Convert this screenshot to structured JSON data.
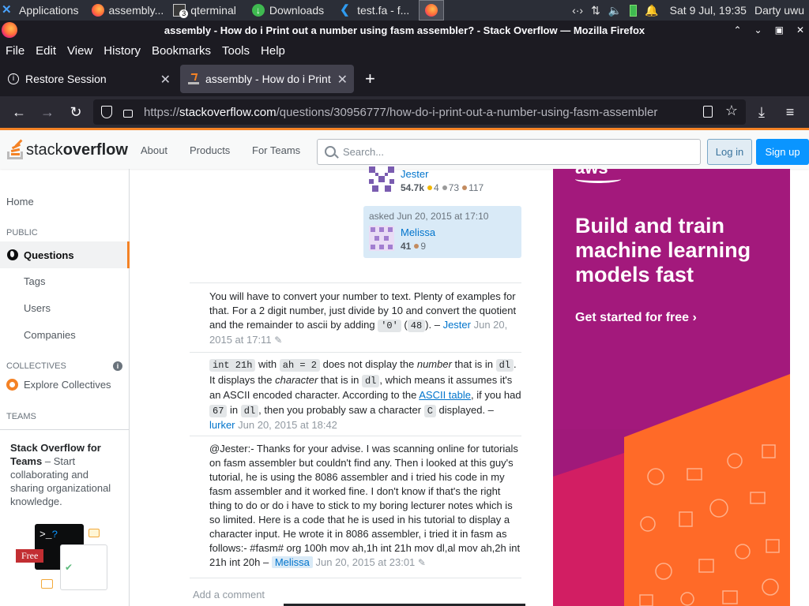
{
  "panel": {
    "applications": "Applications",
    "tasks": [
      {
        "label": "assembly..."
      },
      {
        "label": "qterminal"
      },
      {
        "label": "Downloads"
      },
      {
        "label": "test.fa - f..."
      }
    ],
    "terminal_badge": "3",
    "datetime": "Sat  9 Jul, 19:35",
    "user": "Darty uwu"
  },
  "window": {
    "title": "assembly - How do i Print out a number using fasm assembler? - Stack Overflow — Mozilla Firefox"
  },
  "menu": [
    "File",
    "Edit",
    "View",
    "History",
    "Bookmarks",
    "Tools",
    "Help"
  ],
  "tabs": [
    {
      "label": "Restore Session"
    },
    {
      "label": "assembly - How do i Print out"
    }
  ],
  "url": {
    "scheme": "https://",
    "host": "stackoverflow.com",
    "path": "/questions/30956777/how-do-i-print-out-a-number-using-fasm-assembler"
  },
  "so_header": {
    "logo_part1": "stack",
    "logo_part2": "overflow",
    "nav": [
      "About",
      "Products",
      "For Teams"
    ],
    "search_placeholder": "Search...",
    "login": "Log in",
    "signup": "Sign up"
  },
  "sidebar": {
    "home": "Home",
    "public": "PUBLIC",
    "questions": "Questions",
    "tags": "Tags",
    "users": "Users",
    "companies": "Companies",
    "collectives": "COLLECTIVES",
    "explore_collectives": "Explore Collectives",
    "teams": "TEAMS",
    "teams_title": "Stack Overflow for Teams",
    "teams_desc": " – Start collaborating and sharing organizational knowledge.",
    "free_badge": "Free"
  },
  "post": {
    "editor": {
      "name": "Jester",
      "rep": "54.7k",
      "gold": "4",
      "silver": "73",
      "bronze": "117"
    },
    "asked_label": "asked Jun 20, 2015 at 17:10",
    "asker": {
      "name": "Melissa",
      "rep": "41",
      "bronze": "9"
    }
  },
  "comments": [
    {
      "text1": "You will have to convert your number to text. Plenty of examples for that. For a 2 digit number, just divide by 10 and convert the quotient and the remainder to ascii by adding ",
      "code1": "'0'",
      "text2": " (",
      "code2": "48",
      "text3": "). –",
      "user": "Jester",
      "date": "Jun 20, 2015 at 17:11"
    },
    {
      "code1": "int 21h",
      "text1": " with ",
      "code2": "ah = 2",
      "text2": " does not display the ",
      "em1": "number",
      "text3": " that is in ",
      "code3": "dl",
      "text4": ". It displays the ",
      "em2": "character",
      "text5": " that is in ",
      "code4": "dl",
      "text6": ", which means it assumes it's an ASCII encoded character. According to the ",
      "link": "ASCII table",
      "text7": ", if you had ",
      "code5": "67",
      "text8": " in ",
      "code6": "dl",
      "text9": ", then you probably saw a character ",
      "code7": "C",
      "text10": " displayed. –",
      "user": "lurker",
      "date": "Jun 20, 2015 at 18:42"
    },
    {
      "text": "@Jester:- Thanks for your advise. I was scanning online for tutorials on fasm assembler but couldn't find any. Then i looked at this guy's tutorial, he is using the 8086 assembler and i tried his code in my fasm assembler and it worked fine. I don't know if that's the right thing to do or do i have to stick to my boring lecturer notes which is so limited. Here is a code that he is used in his tutorial to display a character input. He wrote it in 8086 assembler, i tried it in fasm as follows:- #fasm# org 100h mov ah,1h int 21h mov dl,al mov ah,2h int 21h int 20h –",
      "user": "Melissa",
      "date": "Jun 20, 2015 at 23:01"
    }
  ],
  "add_comment": "Add a comment",
  "ad": {
    "brand": "aws",
    "headline": "Build and train machine learning models fast",
    "cta": "Get started for free ›"
  },
  "colors": {
    "so_orange": "#f48225",
    "so_blue": "#0a95ff",
    "link_blue": "#0074cc",
    "ad_magenta": "#a3197c",
    "ad_orange": "#ff6a28"
  }
}
